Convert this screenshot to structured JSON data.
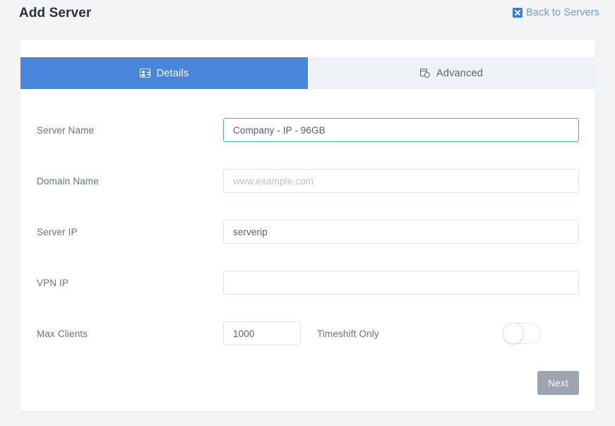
{
  "header": {
    "title": "Add Server",
    "back_link": {
      "label": "Back to Servers",
      "icon": "broken-image-icon",
      "color": "#6f9bdd"
    }
  },
  "tabs": [
    {
      "label": "Details",
      "icon": "id-card-icon",
      "active": true,
      "bg": "#4a85dc"
    },
    {
      "label": "Advanced",
      "icon": "window-cog-icon",
      "active": false,
      "bg": "#eef1f5"
    }
  ],
  "form": {
    "fields": [
      {
        "label": "Server Name",
        "value": "Company - IP - 96GB",
        "placeholder": "",
        "focused": true,
        "focus_color": "#46b3a6"
      },
      {
        "label": "Domain Name",
        "value": "",
        "placeholder": "www.example.com",
        "focused": false
      },
      {
        "label": "Server IP",
        "value": "serverip",
        "placeholder": "",
        "focused": false
      },
      {
        "label": "VPN IP",
        "value": "",
        "placeholder": "",
        "focused": false
      }
    ],
    "max_clients": {
      "label": "Max Clients",
      "value": "1000",
      "placeholder": ""
    },
    "timeshift": {
      "label": "Timeshift Only",
      "enabled": false
    }
  },
  "actions": {
    "next_label": "Next",
    "next_color": "#9aa5ad"
  }
}
